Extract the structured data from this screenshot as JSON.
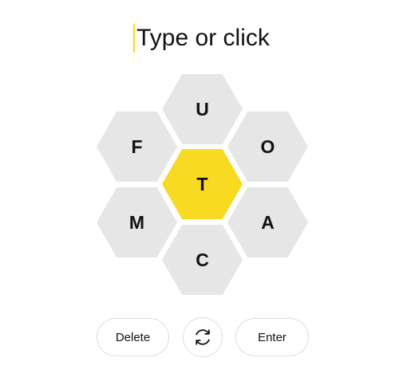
{
  "input": {
    "placeholder": "Type or click"
  },
  "hive": {
    "center_letter": "T",
    "outer_letters": [
      "U",
      "O",
      "A",
      "C",
      "M",
      "F"
    ],
    "colors": {
      "center": "#f7da21",
      "outer": "#e6e6e6"
    }
  },
  "controls": {
    "delete_label": "Delete",
    "shuffle_icon": "shuffle-icon",
    "enter_label": "Enter"
  }
}
